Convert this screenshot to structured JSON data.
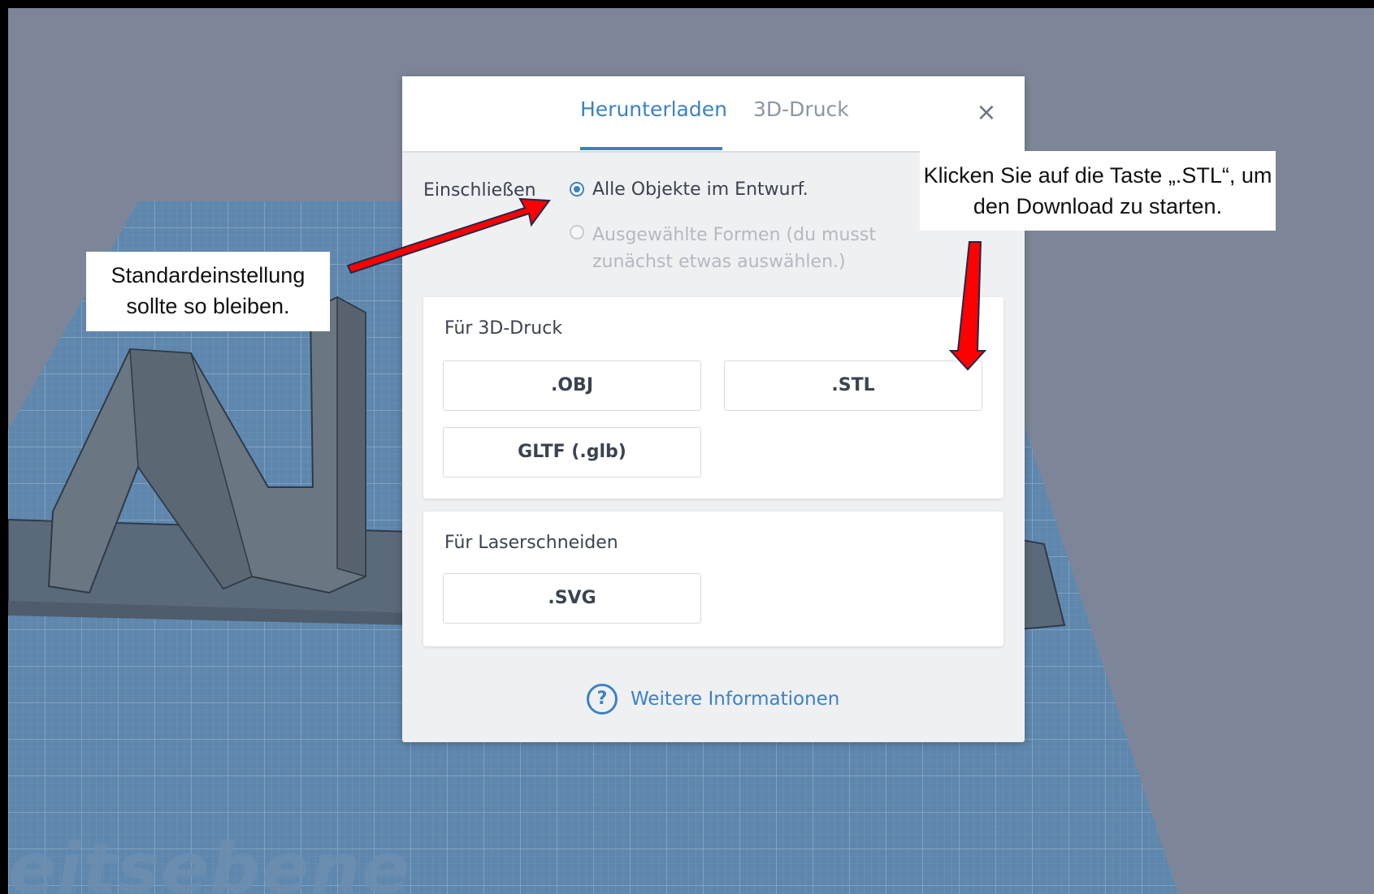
{
  "dialog": {
    "tabs": [
      {
        "label": "Herunterladen",
        "active": true
      },
      {
        "label": "3D-Druck",
        "active": false
      }
    ],
    "close_symbol": "×",
    "include": {
      "label": "Einschließen",
      "options": [
        {
          "label": "Alle Objekte im Entwurf.",
          "selected": true,
          "enabled": true
        },
        {
          "label": "Ausgewählte Formen (du musst zunächst etwas auswählen.)",
          "selected": false,
          "enabled": false
        }
      ]
    },
    "print_section": {
      "title": "Für 3D-Druck",
      "buttons": [
        ".OBJ",
        ".STL",
        "GLTF (.glb)"
      ]
    },
    "laser_section": {
      "title": "Für Laserschneiden",
      "buttons": [
        ".SVG"
      ]
    },
    "info_link": {
      "icon": "?",
      "label": "Weitere Informationen"
    }
  },
  "annotations": {
    "left": "Standardeinstellung sollte so bleiben.",
    "right": "Klicken Sie auf die Taste „.STL“, um den Download zu starten."
  },
  "workplane_watermark": "eitsebene",
  "colors": {
    "accent": "#3b82c4",
    "arrow": "#ff0000",
    "workplane": "#5f87ad",
    "background": "#7d8698"
  }
}
